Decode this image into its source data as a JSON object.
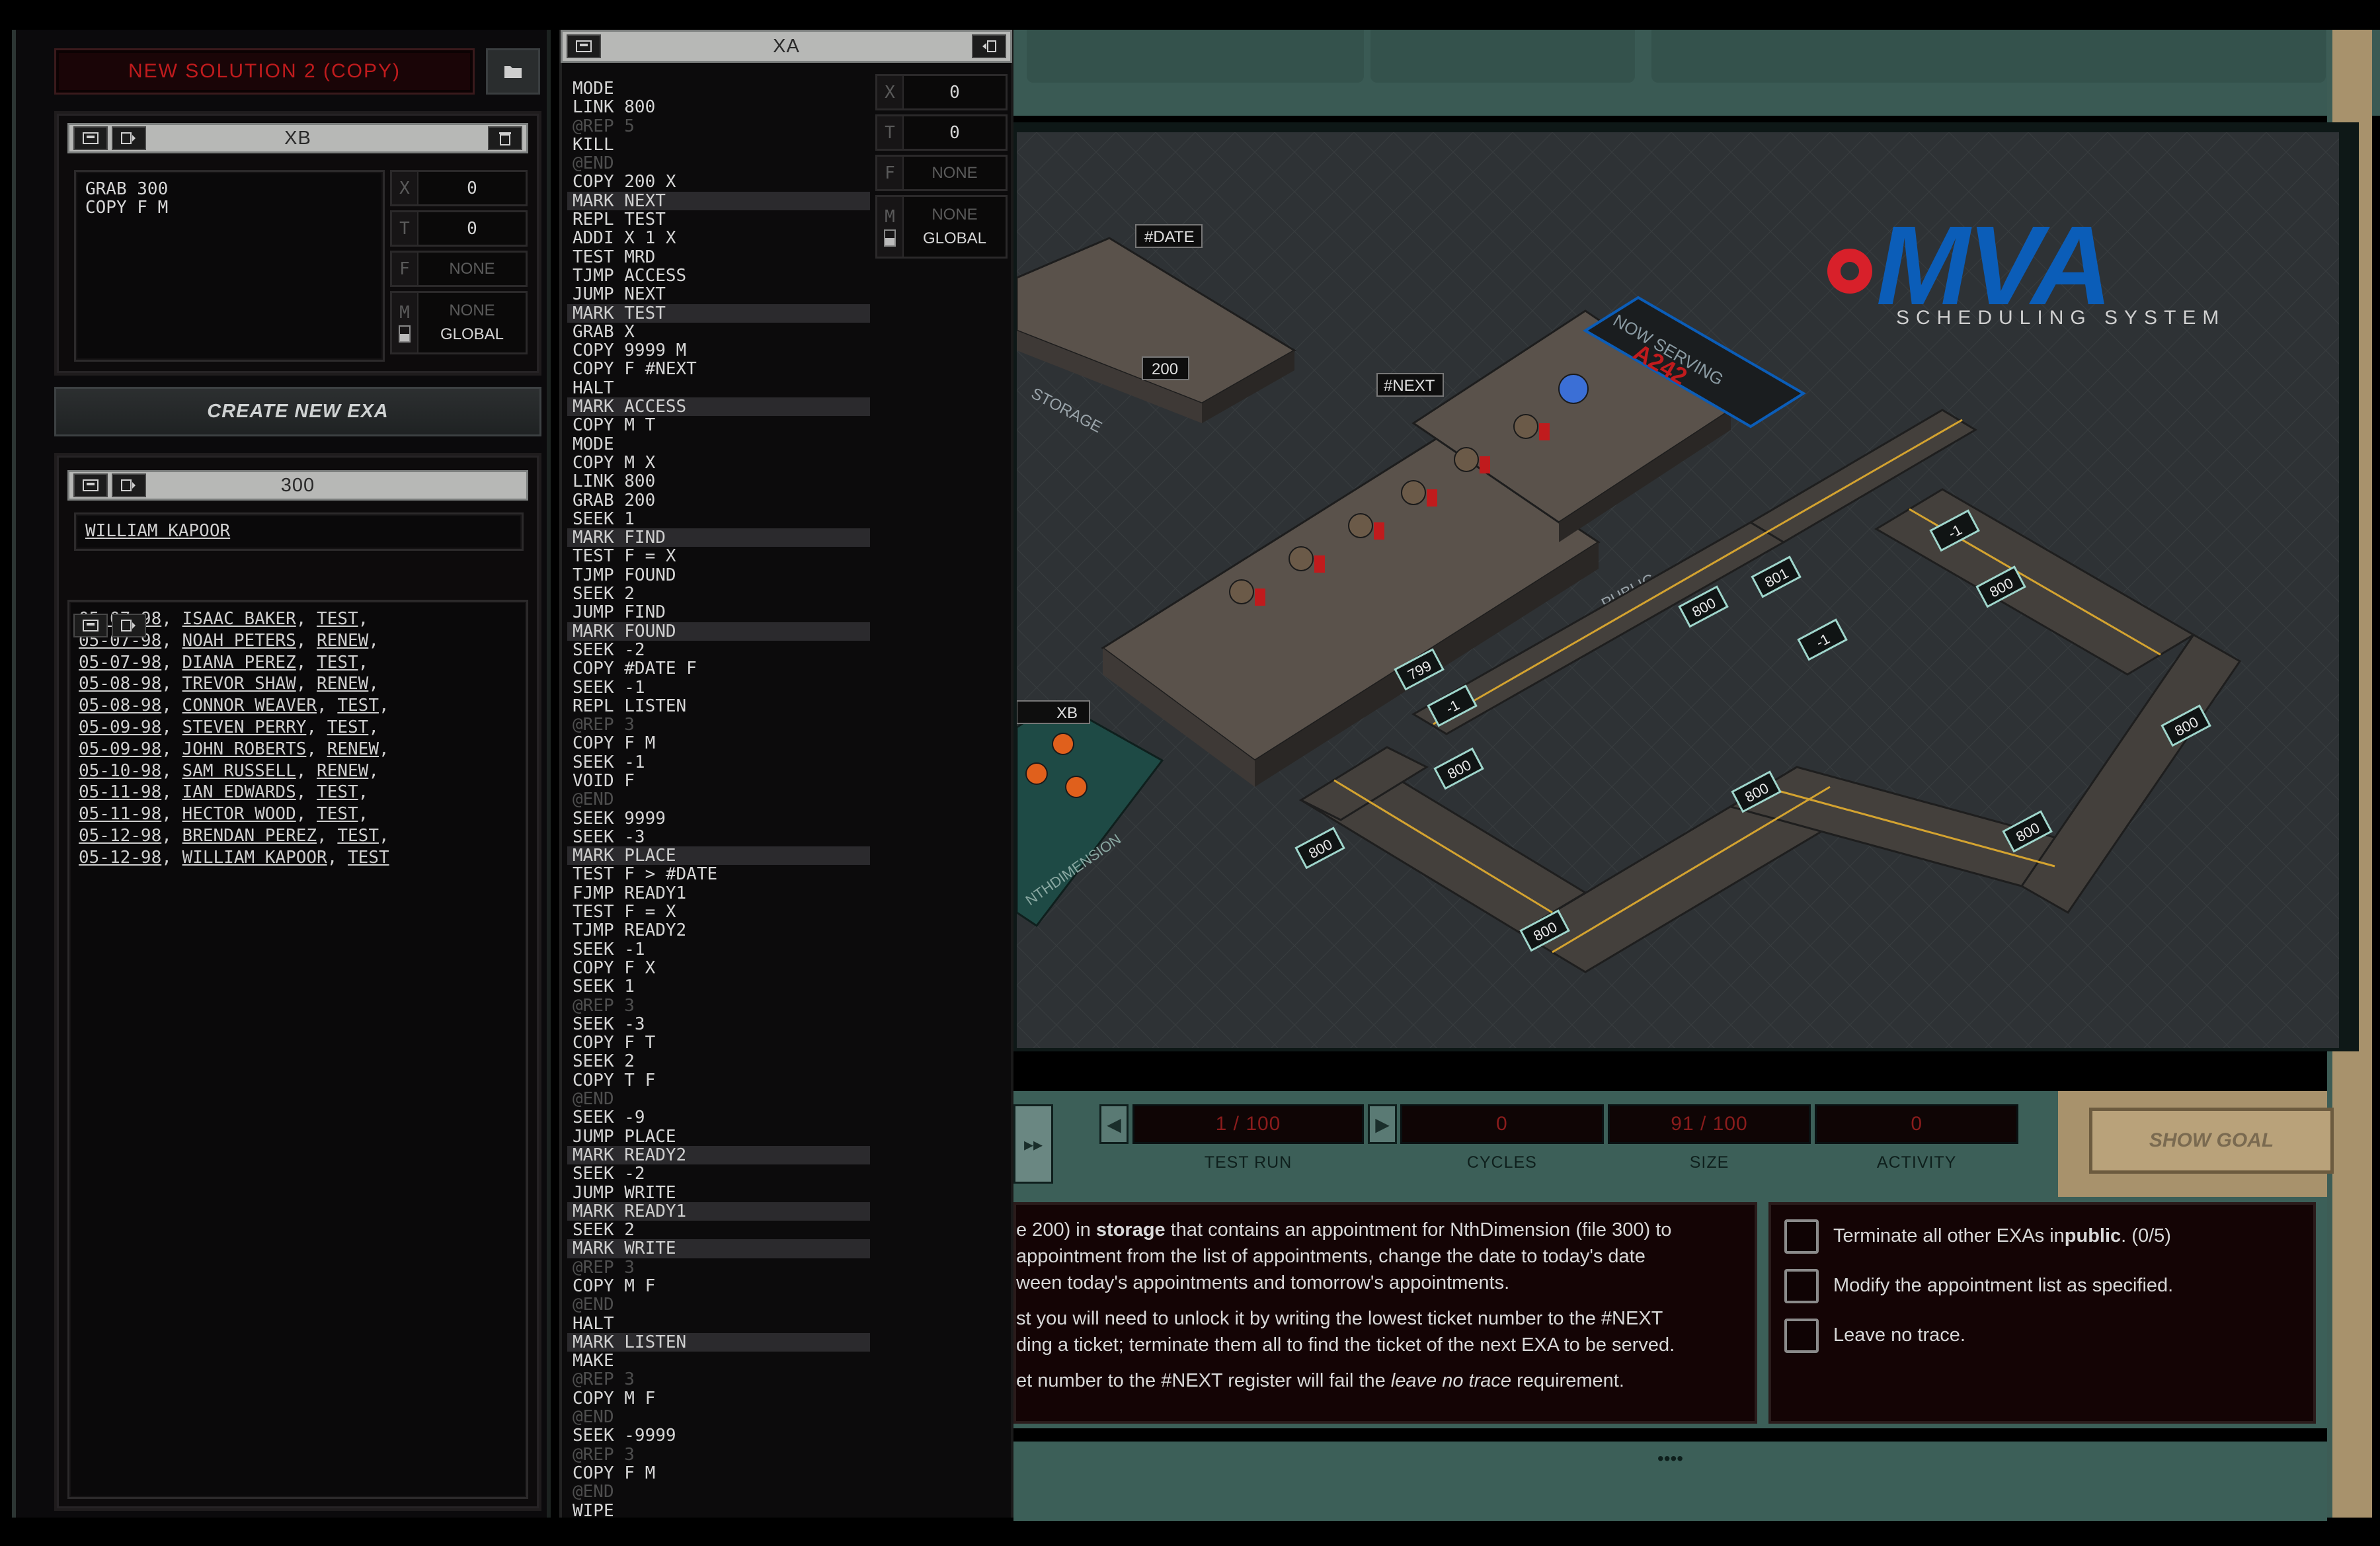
{
  "solution": {
    "title": "NEW SOLUTION 2 (COPY)",
    "folder_icon": "folder-icon"
  },
  "xb": {
    "title": "XB",
    "code": "GRAB 300\nCOPY F M",
    "registers": {
      "x_label": "X",
      "x": "0",
      "t_label": "T",
      "t": "0",
      "f_label": "F",
      "f": "NONE",
      "m_label": "M",
      "m_line1": "NONE",
      "m_line2": "GLOBAL"
    }
  },
  "create_exa_label": "CREATE NEW EXA",
  "file300": {
    "title": "300",
    "content": "WILLIAM KAPOOR"
  },
  "file200": {
    "title": "200",
    "rows": [
      {
        "date": "05-07-98",
        "name": "ISAAC BAKER",
        "type": "TEST"
      },
      {
        "date": "05-07-98",
        "name": "NOAH PETERS",
        "type": "RENEW"
      },
      {
        "date": "05-07-98",
        "name": "DIANA PEREZ",
        "type": "TEST"
      },
      {
        "date": "05-08-98",
        "name": "TREVOR SHAW",
        "type": "RENEW"
      },
      {
        "date": "05-08-98",
        "name": "CONNOR WEAVER",
        "type": "TEST"
      },
      {
        "date": "05-09-98",
        "name": "STEVEN PERRY",
        "type": "TEST"
      },
      {
        "date": "05-09-98",
        "name": "JOHN ROBERTS",
        "type": "RENEW"
      },
      {
        "date": "05-10-98",
        "name": "SAM RUSSELL",
        "type": "RENEW"
      },
      {
        "date": "05-11-98",
        "name": "IAN EDWARDS",
        "type": "TEST"
      },
      {
        "date": "05-11-98",
        "name": "HECTOR WOOD",
        "type": "TEST"
      },
      {
        "date": "05-12-98",
        "name": "BRENDAN PEREZ",
        "type": "TEST"
      },
      {
        "date": "05-12-98",
        "name": "WILLIAM KAPOOR",
        "type": "TEST"
      }
    ]
  },
  "xa": {
    "title": "XA",
    "registers": {
      "x_label": "X",
      "x": "0",
      "t_label": "T",
      "t": "0",
      "f_label": "F",
      "f": "NONE",
      "m_label": "M",
      "m_line1": "NONE",
      "m_line2": "GLOBAL"
    },
    "lines": [
      {
        "t": "MODE",
        "k": ""
      },
      {
        "t": "LINK 800",
        "k": ""
      },
      {
        "t": "@REP 5",
        "k": "grey"
      },
      {
        "t": "KILL",
        "k": ""
      },
      {
        "t": "@END",
        "k": "grey"
      },
      {
        "t": "COPY 200 X",
        "k": ""
      },
      {
        "t": "MARK NEXT",
        "k": "mark"
      },
      {
        "t": "REPL TEST",
        "k": ""
      },
      {
        "t": "ADDI X 1 X",
        "k": ""
      },
      {
        "t": "TEST MRD",
        "k": ""
      },
      {
        "t": "TJMP ACCESS",
        "k": ""
      },
      {
        "t": "JUMP NEXT",
        "k": ""
      },
      {
        "t": "MARK TEST",
        "k": "mark"
      },
      {
        "t": "GRAB X",
        "k": ""
      },
      {
        "t": "COPY 9999 M",
        "k": ""
      },
      {
        "t": "COPY F #NEXT",
        "k": ""
      },
      {
        "t": "HALT",
        "k": ""
      },
      {
        "t": "MARK ACCESS",
        "k": "mark"
      },
      {
        "t": "COPY M T",
        "k": ""
      },
      {
        "t": "MODE",
        "k": ""
      },
      {
        "t": "COPY M X",
        "k": ""
      },
      {
        "t": "LINK 800",
        "k": ""
      },
      {
        "t": "GRAB 200",
        "k": ""
      },
      {
        "t": "SEEK 1",
        "k": ""
      },
      {
        "t": "MARK FIND",
        "k": "mark"
      },
      {
        "t": "TEST F = X",
        "k": ""
      },
      {
        "t": "TJMP FOUND",
        "k": ""
      },
      {
        "t": "SEEK 2",
        "k": ""
      },
      {
        "t": "JUMP FIND",
        "k": ""
      },
      {
        "t": "MARK FOUND",
        "k": "mark"
      },
      {
        "t": "SEEK -2",
        "k": ""
      },
      {
        "t": "COPY #DATE F",
        "k": ""
      },
      {
        "t": "SEEK -1",
        "k": ""
      },
      {
        "t": "REPL LISTEN",
        "k": ""
      },
      {
        "t": "@REP 3",
        "k": "grey"
      },
      {
        "t": "COPY F M",
        "k": ""
      },
      {
        "t": "SEEK -1",
        "k": ""
      },
      {
        "t": "VOID F",
        "k": ""
      },
      {
        "t": "@END",
        "k": "grey"
      },
      {
        "t": "SEEK 9999",
        "k": ""
      },
      {
        "t": "SEEK -3",
        "k": ""
      },
      {
        "t": "MARK PLACE",
        "k": "mark"
      },
      {
        "t": "TEST F > #DATE",
        "k": ""
      },
      {
        "t": "FJMP READY1",
        "k": ""
      },
      {
        "t": "TEST F = X",
        "k": ""
      },
      {
        "t": "TJMP READY2",
        "k": ""
      },
      {
        "t": "SEEK -1",
        "k": ""
      },
      {
        "t": "COPY F X",
        "k": ""
      },
      {
        "t": "SEEK 1",
        "k": ""
      },
      {
        "t": "@REP 3",
        "k": "grey"
      },
      {
        "t": "SEEK -3",
        "k": ""
      },
      {
        "t": "COPY F T",
        "k": ""
      },
      {
        "t": "SEEK 2",
        "k": ""
      },
      {
        "t": "COPY T F",
        "k": ""
      },
      {
        "t": "@END",
        "k": "grey"
      },
      {
        "t": "SEEK -9",
        "k": ""
      },
      {
        "t": "JUMP PLACE",
        "k": ""
      },
      {
        "t": "MARK READY2",
        "k": "mark"
      },
      {
        "t": "SEEK -2",
        "k": ""
      },
      {
        "t": "JUMP WRITE",
        "k": ""
      },
      {
        "t": "MARK READY1",
        "k": "mark"
      },
      {
        "t": "SEEK 2",
        "k": ""
      },
      {
        "t": "MARK WRITE",
        "k": "mark"
      },
      {
        "t": "@REP 3",
        "k": "grey"
      },
      {
        "t": "COPY M F",
        "k": ""
      },
      {
        "t": "@END",
        "k": "grey"
      },
      {
        "t": "HALT",
        "k": ""
      },
      {
        "t": "MARK LISTEN",
        "k": "mark"
      },
      {
        "t": "MAKE",
        "k": ""
      },
      {
        "t": "@REP 3",
        "k": "grey"
      },
      {
        "t": "COPY M F",
        "k": ""
      },
      {
        "t": "@END",
        "k": "grey"
      },
      {
        "t": "SEEK -9999",
        "k": ""
      },
      {
        "t": "@REP 3",
        "k": "grey"
      },
      {
        "t": "COPY F M",
        "k": ""
      },
      {
        "t": "@END",
        "k": "grey"
      },
      {
        "t": "WIPE",
        "k": ""
      }
    ]
  },
  "scene": {
    "logo_text": "MVA",
    "logo_sub": "SCHEDULING SYSTEM",
    "now_serving_label": "NOW SERVING",
    "now_serving_value": "A242",
    "host_labels": {
      "storage": "STORAGE",
      "public": "PUBLIC",
      "nth": "NTHDIMENSION"
    },
    "file_tags": {
      "date": "#DATE",
      "file200": "200",
      "next": "#NEXT",
      "xb": "XB"
    },
    "link_labels": [
      "800",
      "801",
      "800",
      "-1",
      "799",
      "-1",
      "800",
      "800",
      "800",
      "800",
      "800",
      "800",
      "-1"
    ]
  },
  "controls": {
    "test_run": "1 / 100",
    "test_run_label": "TEST RUN",
    "cycles": "0",
    "cycles_label": "CYCLES",
    "size": "91 / 100",
    "size_label": "SIZE",
    "activity": "0",
    "activity_label": "ACTIVITY",
    "show_goal": "SHOW GOAL"
  },
  "description": {
    "line1_pre": "e 200) in ",
    "line1_bold": "storage",
    "line1_post": " that contains an appointment for NthDimension (file 300) to",
    "line2": "appointment from the list of appointments, change the date to today's date",
    "line3": "ween today's appointments and tomorrow's appointments.",
    "line4": "st you will need to unlock it by writing the lowest ticket number to the #NEXT",
    "line5": "ding a ticket; terminate them all to find the ticket of the next EXA to be served.",
    "line6_pre": "et number to the #NEXT register will fail the ",
    "line6_em": "leave no trace",
    "line6_post": " requirement."
  },
  "goals": [
    {
      "pre": "Terminate all other EXAs in ",
      "bold": "public",
      "post": ". (0/5)"
    },
    {
      "pre": "Modify the appointment list as specified.",
      "bold": "",
      "post": ""
    },
    {
      "pre": "Leave no trace.",
      "bold": "",
      "post": ""
    }
  ],
  "bottom_dots": "••••"
}
